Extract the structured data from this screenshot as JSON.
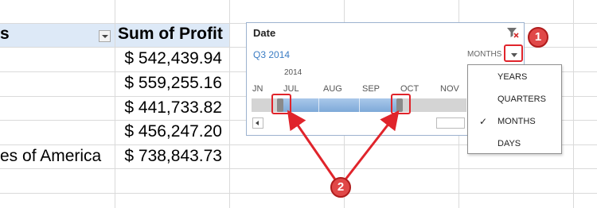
{
  "sheet": {
    "row_labels_header": "s",
    "value_header": "Sum of Profit",
    "values": [
      "$ 542,439.94",
      "$ 559,255.16",
      "$ 441,733.82",
      "$ 456,247.20",
      "$ 738,843.73"
    ],
    "row_labels": [
      "",
      "",
      "",
      "",
      "es of America"
    ]
  },
  "timeline": {
    "title": "Date",
    "period": "Q3 2014",
    "level": "MONTHS",
    "year_label": "2014",
    "months": [
      "JN",
      "JUL",
      "AUG",
      "SEP",
      "OCT",
      "NOV"
    ],
    "icons": [
      "clear-filter-icon",
      "level-dropdown-icon",
      "scroll-left-icon"
    ]
  },
  "level_menu": {
    "items": [
      "YEARS",
      "QUARTERS",
      "MONTHS",
      "DAYS"
    ],
    "selected": "MONTHS",
    "check_glyph": "✓"
  },
  "annotations": {
    "step1": "1",
    "step2": "2",
    "color": "#e0242b"
  }
}
